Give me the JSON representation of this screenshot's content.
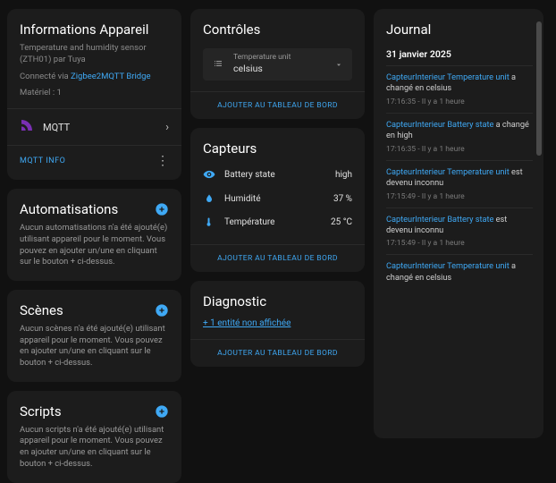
{
  "device": {
    "title": "Informations Appareil",
    "name_line": "Temperature and humidity sensor (ZTH01) par Tuya",
    "connected_prefix": "Connecté via ",
    "bridge_link": "Zigbee2MQTT Bridge",
    "material_line": "Matériel : 1",
    "mqtt_label": "MQTT",
    "mqtt_info": "MQTT INFO"
  },
  "automations": {
    "title": "Automatisations",
    "desc": "Aucun automatisations n'a été ajouté(e) utilisant appareil pour le moment. Vous pouvez en ajouter un/une en cliquant sur le bouton + ci-dessus."
  },
  "scenes": {
    "title": "Scènes",
    "desc": "Aucun scènes n'a été ajouté(e) utilisant appareil pour le moment. Vous pouvez en ajouter un/une en cliquant sur le bouton + ci-dessus."
  },
  "scripts": {
    "title": "Scripts",
    "desc": "Aucun scripts n'a été ajouté(e) utilisant appareil pour le moment. Vous pouvez en ajouter un/une en cliquant sur le bouton + ci-dessus."
  },
  "controls": {
    "title": "Contrôles",
    "select_label": "Temperature unit",
    "select_value": "celsius",
    "footer": "AJOUTER AU TABLEAU DE BORD"
  },
  "sensors": {
    "title": "Capteurs",
    "rows": [
      {
        "name": "Battery state",
        "value": "high"
      },
      {
        "name": "Humidité",
        "value": "37 %"
      },
      {
        "name": "Température",
        "value": "25 °C"
      }
    ],
    "footer": "AJOUTER AU TABLEAU DE BORD"
  },
  "diagnostic": {
    "title": "Diagnostic",
    "hidden_entities": "+ 1 entité non affichée",
    "footer": "AJOUTER AU TABLEAU DE BORD"
  },
  "journal": {
    "title": "Journal",
    "date": "31 janvier 2025",
    "entries": [
      {
        "entity": "CapteurInterieur Temperature unit",
        "rest": " a changé en celsius",
        "time": "17:16:35 - Il y a 1 heure"
      },
      {
        "entity": "CapteurInterieur Battery state",
        "rest": " a changé en high",
        "time": "17:16:35 - Il y a 1 heure"
      },
      {
        "entity": "CapteurInterieur Temperature unit",
        "rest": " est devenu inconnu",
        "time": "17:15:49 - Il y a 1 heure"
      },
      {
        "entity": "CapteurInterieur Battery state",
        "rest": " est devenu inconnu",
        "time": "17:15:49 - Il y a 1 heure"
      },
      {
        "entity": "CapteurInterieur Temperature unit",
        "rest": " a changé en celsius",
        "time": ""
      }
    ]
  }
}
